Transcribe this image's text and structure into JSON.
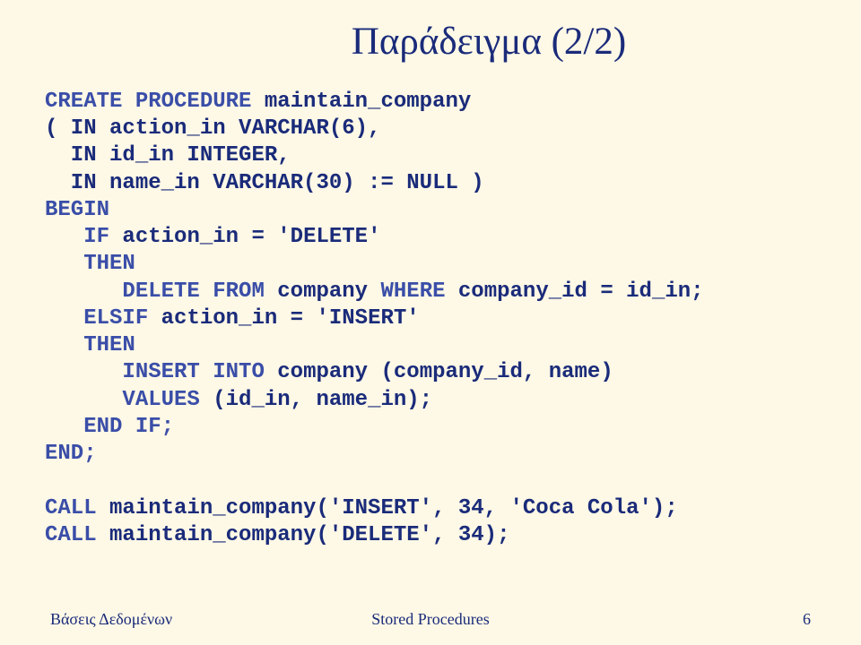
{
  "title": "Παράδειγμα (2/2)",
  "code": {
    "l1_kw": "CREATE PROCEDURE",
    "l1_txt": " maintain_company",
    "l2_txt": "( IN action_in VARCHAR(6),",
    "l3_txt": "  IN id_in INTEGER,",
    "l4_txt": "  IN name_in VARCHAR(30) := NULL )",
    "l5_kw": "BEGIN",
    "l6a": "   ",
    "l6_kw": "IF",
    "l6_txt": " action_in = 'DELETE'",
    "l7a": "   ",
    "l7_kw": "THEN",
    "l8a": "      ",
    "l8_kw1": "DELETE FROM",
    "l8_mid": " company ",
    "l8_kw2": "WHERE",
    "l8_end": " company_id = id_in;",
    "l9a": "   ",
    "l9_kw": "ELSIF",
    "l9_txt": " action_in = 'INSERT'",
    "l10a": "   ",
    "l10_kw": "THEN",
    "l11a": "      ",
    "l11_kw": "INSERT INTO",
    "l11_txt": " company (company_id, name)",
    "l12a": "      ",
    "l12_kw": "VALUES",
    "l12_txt": " (id_in, name_in);",
    "l13a": "   ",
    "l13_kw": "END IF;",
    "l14_kw": "END;",
    "l15_kw": "CALL",
    "l15_txt": " maintain_company('INSERT', 34, 'Coca Cola');",
    "l16_kw": "CALL",
    "l16_txt": " maintain_company('DELETE', 34);"
  },
  "footer": {
    "left": "Βάσεις Δεδομένων",
    "center": "Stored Procedures",
    "right": "6"
  }
}
